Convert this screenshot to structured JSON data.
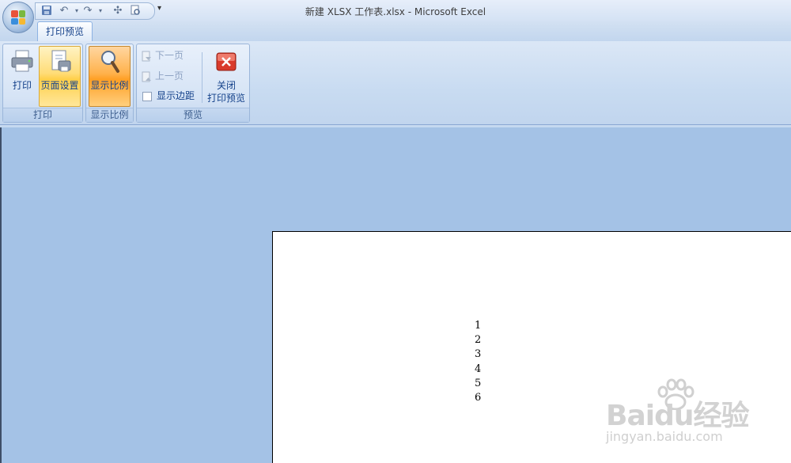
{
  "window": {
    "title": "新建 XLSX 工作表.xlsx - Microsoft Excel"
  },
  "ribbon": {
    "tab_label": "打印预览",
    "groups": {
      "print": {
        "label": "打印",
        "print_button": "打印",
        "page_setup_button": "页面设置"
      },
      "zoom": {
        "label": "显示比例",
        "zoom_button": "显示比例"
      },
      "preview": {
        "label": "预览",
        "next_page": "下一页",
        "prev_page": "上一页",
        "show_margins": "显示边距",
        "close_line1": "关闭",
        "close_line2": "打印预览"
      }
    }
  },
  "sheet": {
    "cells": [
      "1",
      "2",
      "3",
      "4",
      "5",
      "6"
    ]
  },
  "watermark": {
    "brand": "Baidu经验",
    "url": "jingyan.baidu.com"
  },
  "colors": {
    "ribbon_text": "#15428b",
    "active_button": "#ffcf4a",
    "workspace_bg": "#a4c2e6"
  }
}
